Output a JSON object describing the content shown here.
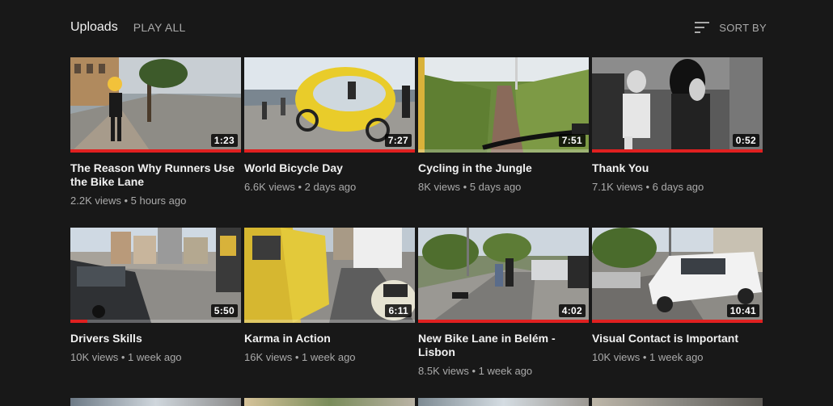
{
  "header": {
    "title": "Uploads",
    "play_all": "PLAY ALL",
    "sort_by": "SORT BY"
  },
  "videos": [
    {
      "title": "The Reason Why Runners Use the Bike Lane",
      "views": "2.2K views",
      "age": "5 hours ago",
      "duration": "1:23",
      "watched_fraction": 1.0
    },
    {
      "title": "World Bicycle Day",
      "views": "6.6K views",
      "age": "2 days ago",
      "duration": "7:27",
      "watched_fraction": 1.0
    },
    {
      "title": "Cycling in the Jungle",
      "views": "8K views",
      "age": "5 days ago",
      "duration": "7:51",
      "watched_fraction": 0.0
    },
    {
      "title": "Thank You",
      "views": "7.1K views",
      "age": "6 days ago",
      "duration": "0:52",
      "watched_fraction": 1.0
    },
    {
      "title": "Drivers Skills",
      "views": "10K views",
      "age": "1 week ago",
      "duration": "5:50",
      "watched_fraction": 0.1
    },
    {
      "title": "Karma in Action",
      "views": "16K views",
      "age": "1 week ago",
      "duration": "6:11",
      "watched_fraction": 0.0
    },
    {
      "title": "New Bike Lane in Belém - Lisbon",
      "views": "8.5K views",
      "age": "1 week ago",
      "duration": "4:02",
      "watched_fraction": 1.0
    },
    {
      "title": "Visual Contact is Important",
      "views": "10K views",
      "age": "1 week ago",
      "duration": "10:41",
      "watched_fraction": 1.0
    }
  ],
  "colors": {
    "background": "#181818",
    "progress": "#e02020",
    "text_primary": "#f1f1f1",
    "text_secondary": "#aaaaaa"
  },
  "icons": {
    "sort": "sort-lines-icon"
  }
}
